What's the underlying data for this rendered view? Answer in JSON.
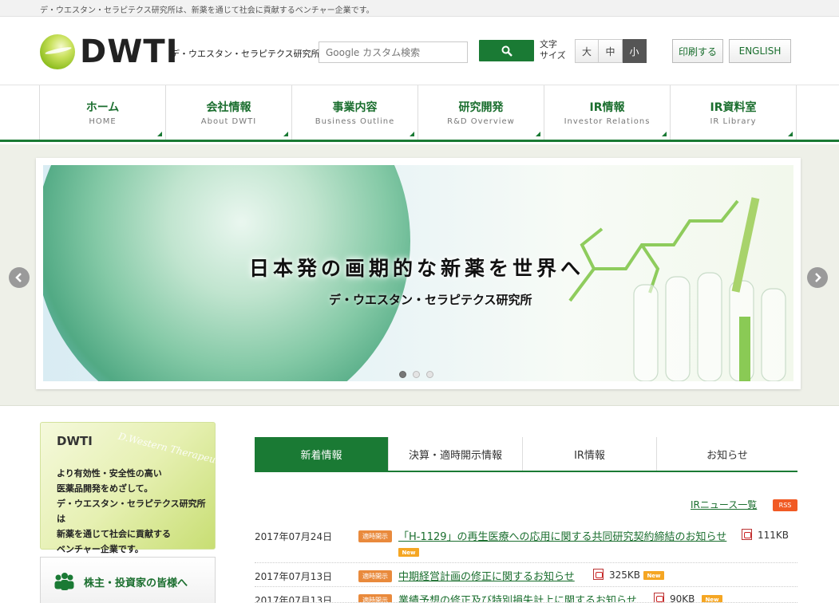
{
  "topbar": {
    "text": "デ・ウエスタン・セラピテクス研究所は、新薬を通じて社会に貢献するベンチャー企業です。"
  },
  "header": {
    "logo_text": "DWTI",
    "logo_sub": "デ・ウエスタン・セラピテクス研究所",
    "search_placeholder": "Google カスタム検索",
    "font_size_label": "文字\nサイズ",
    "font_sizes": [
      "大",
      "中",
      "小"
    ],
    "font_size_active": "小",
    "print_label": "印刷する",
    "english_label": "ENGLISH"
  },
  "gnav": [
    {
      "ja": "ホーム",
      "en": "HOME"
    },
    {
      "ja": "会社情報",
      "en": "About DWTI"
    },
    {
      "ja": "事業内容",
      "en": "Business Outline"
    },
    {
      "ja": "研究開発",
      "en": "R&D Overview"
    },
    {
      "ja": "IR情報",
      "en": "Investor Relations"
    },
    {
      "ja": "IR資料室",
      "en": "IR Library"
    }
  ],
  "hero": {
    "title": "日本発の画期的な新薬を世界へ",
    "subtitle": "デ・ウエスタン・セラピテクス研究所",
    "slide_count": 3,
    "active_slide": 1
  },
  "sidebar": {
    "box_title": "DWTI",
    "box_watermark": "D.Western Therapeutics Inc",
    "box_desc": "より有効性・安全性の高い\n医薬品開発をめざして。\nデ・ウエスタン・セラピテクス研究所は\n新薬を通じて社会に貢献する\nベンチャー企業です。",
    "ir_label": "株主・投資家の皆様へ"
  },
  "tabs": [
    "新着情報",
    "決算・適時開示情報",
    "IR情報",
    "お知らせ"
  ],
  "active_tab": "新着情報",
  "news_header": {
    "list_link": "IRニュース一覧",
    "rss": "RSS"
  },
  "news": [
    {
      "date": "2017年07月24日",
      "category": "適時開示",
      "title": "「H-1129」の再生医療への応用に関する共同研究契約締結のお知らせ",
      "size": "111KB",
      "new": "New"
    },
    {
      "date": "2017年07月13日",
      "category": "適時開示",
      "title": "中期経営計画の修正に関するお知らせ",
      "size": "325KB",
      "new": "New"
    },
    {
      "date": "2017年07月13日",
      "category": "適時開示",
      "title": "業績予想の修正及び特別損失計上に関するお知らせ",
      "size": "90KB",
      "new": "New"
    }
  ]
}
